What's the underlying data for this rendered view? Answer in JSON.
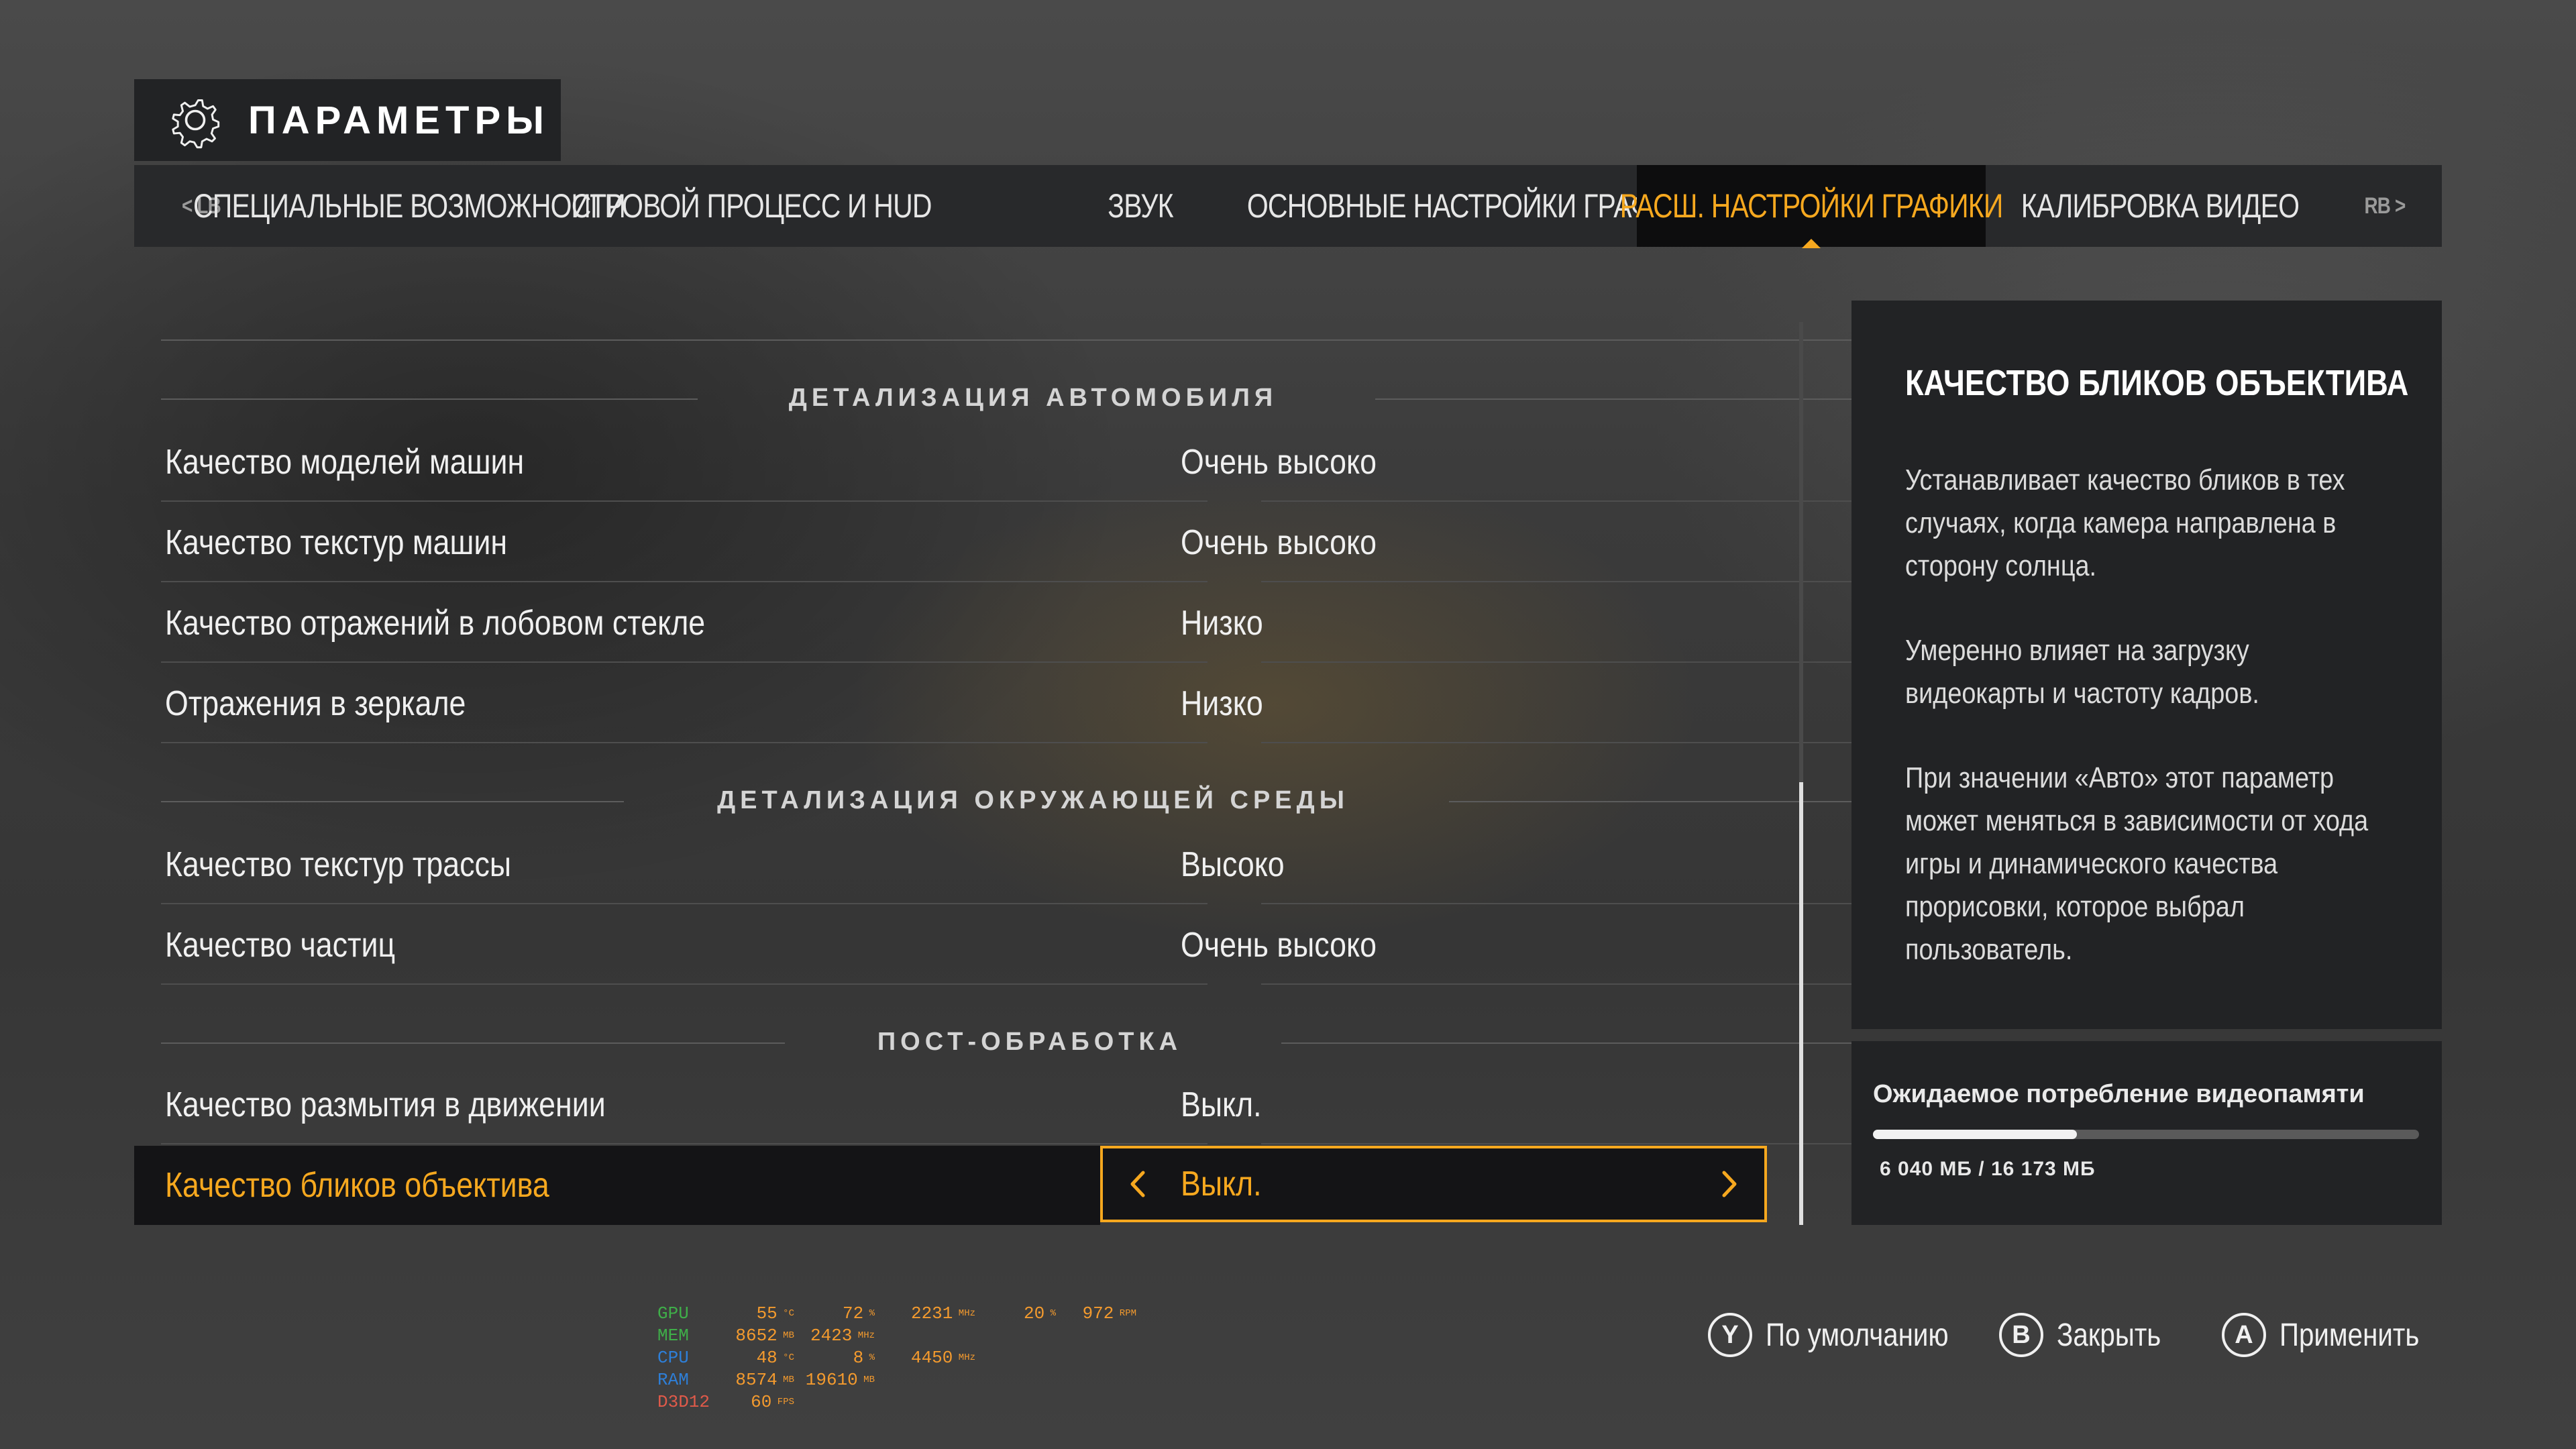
{
  "header": {
    "title": "ПАРАМЕТРЫ",
    "icon": "gear-icon"
  },
  "tabs": {
    "prev_bumper": "< LB",
    "next_bumper": "RB >",
    "items": [
      {
        "label": "СПЕЦИАЛЬНЫЕ ВОЗМОЖНОСТИ",
        "active": false
      },
      {
        "label": "ИГРОВОЙ ПРОЦЕСС И HUD",
        "active": false
      },
      {
        "label": "ЗВУК",
        "active": false
      },
      {
        "label": "ОСНОВНЫЕ НАСТРОЙКИ ГРАФИКИ",
        "active": false
      },
      {
        "label": "РАСШ. НАСТРОЙКИ ГРАФИКИ",
        "active": true
      },
      {
        "label": "КАЛИБРОВКА ВИДЕО",
        "active": false
      }
    ]
  },
  "sections": [
    {
      "title": "ДЕТАЛИЗАЦИЯ АВТОМОБИЛЯ",
      "rows": [
        {
          "label": "Качество моделей машин",
          "value": "Очень высоко"
        },
        {
          "label": "Качество текстур машин",
          "value": "Очень высоко"
        },
        {
          "label": "Качество отражений в лобовом стекле",
          "value": "Низко"
        },
        {
          "label": "Отражения в зеркале",
          "value": "Низко"
        }
      ]
    },
    {
      "title": "ДЕТАЛИЗАЦИЯ ОКРУЖАЮЩЕЙ СРЕДЫ",
      "rows": [
        {
          "label": "Качество текстур трассы",
          "value": "Высоко"
        },
        {
          "label": "Качество частиц",
          "value": "Очень высоко"
        }
      ]
    },
    {
      "title": "ПОСТ-ОБРАБОТКА",
      "rows": [
        {
          "label": "Качество размытия в движении",
          "value": "Выкл."
        },
        {
          "label": "Качество бликов объектива",
          "value": "Выкл.",
          "selected": true
        }
      ]
    }
  ],
  "scroll_position": 0.51,
  "description": {
    "title": "КАЧЕСТВО БЛИКОВ ОБЪЕКТИВА",
    "paragraphs": [
      "Устанавливает качество бликов в тех случаях, когда камера направлена в сторону солнца.",
      "Умеренно влияет на загрузку видеокарты и частоту кадров.",
      "При значении «Авто» этот параметр может меняться в зависимости от хода игры и динамического качества прорисовки, которое выбрал пользователь."
    ]
  },
  "vram": {
    "title": "Ожидаемое потребление видеопамяти",
    "value_text": "6 040 МБ / 16 173 МБ",
    "used_fraction": 0.373
  },
  "overlay": {
    "rows": [
      {
        "key": "GPU",
        "color": "#3fae49",
        "values": [
          "55",
          "72",
          "2231",
          "20",
          "972"
        ],
        "units": [
          "°C",
          "%",
          "MHz",
          "%",
          "RPM"
        ]
      },
      {
        "key": "MEM",
        "color": "#3fae49",
        "values": [
          "8652",
          "2423"
        ],
        "units": [
          "MB",
          "MHz"
        ]
      },
      {
        "key": "CPU",
        "color": "#2e7fd8",
        "values": [
          "48",
          "8",
          "4450"
        ],
        "units": [
          "°C",
          "%",
          "MHz"
        ]
      },
      {
        "key": "RAM",
        "color": "#2e7fd8",
        "values": [
          "8574",
          "19610"
        ],
        "units": [
          "MB",
          "MB"
        ]
      },
      {
        "key": "D3D12",
        "color": "#e05a4a",
        "values": [
          "60"
        ],
        "units": [
          "FPS"
        ]
      }
    ]
  },
  "footer": {
    "buttons": [
      {
        "glyph": "Y",
        "label": "По умолчанию"
      },
      {
        "glyph": "B",
        "label": "Закрыть"
      },
      {
        "glyph": "A",
        "label": "Применить"
      }
    ]
  },
  "colors": {
    "accent": "#f6a81f",
    "panel": "#222325",
    "tab_bar": "#28292b"
  }
}
